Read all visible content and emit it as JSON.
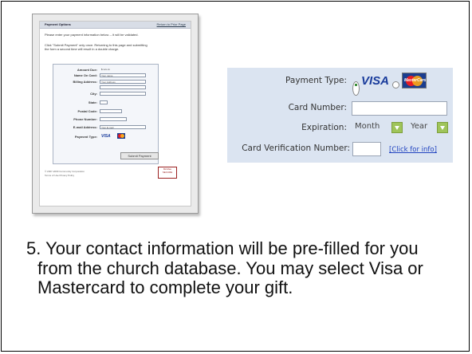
{
  "thumbnail": {
    "header_title": "Payment Options",
    "header_link": "Return to Prior Page",
    "intro_line1": "Please enter your payment information below -- it will be validated.",
    "intro_line2": "Click \"Submit Payment\" only once. Returning to this page and submitting",
    "intro_line3": "the form a second time will result in a double charge.",
    "fields": [
      {
        "label": "Amount Due:",
        "value": "$ xxx.xx"
      },
      {
        "label": "Name On Card:",
        "value": "Your name"
      },
      {
        "label": "Billing Address:",
        "value": "Your Address"
      },
      {
        "label": "City:",
        "value": ""
      },
      {
        "label": "State:",
        "value": ""
      },
      {
        "label": "Postal Code:",
        "value": ""
      },
      {
        "label": "Phone Number:",
        "value": ""
      },
      {
        "label": "E-mail Address:",
        "value": "Your E-mail"
      },
      {
        "label": "Payment Type:",
        "value": ""
      }
    ],
    "submit_label": "Submit Payment",
    "footer_line1": "© 2007-2009 Community Corporation",
    "footer_line2": "Terms of Use   Privacy Policy",
    "seal_text": "McAfee SECURE",
    "mini_visa": "VISA"
  },
  "payment": {
    "payment_type_label": "Payment Type:",
    "visa_text": "VISA",
    "mastercard_text": "MasterCard",
    "card_number_label": "Card Number:",
    "expiration_label": "Expiration:",
    "month_value": "Month",
    "year_value": "Year",
    "cvn_label": "Card Verification Number:",
    "cvn_link": "[Click for info]"
  },
  "caption": {
    "text": "5. Your contact information will be pre-filled for you from the church database. You may select Visa or Mastercard to complete your gift."
  },
  "colors": {
    "panel_bg": "#dbe4f1",
    "link": "#2144c0",
    "select_arrow": "#9fc45a"
  }
}
